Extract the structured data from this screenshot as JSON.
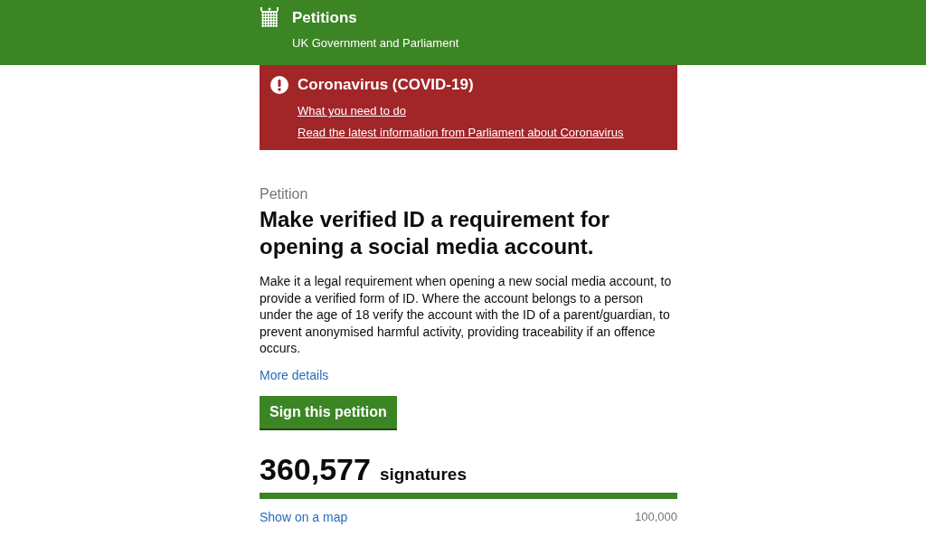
{
  "header": {
    "title": "Petitions",
    "subtitle": "UK Government and Parliament"
  },
  "alert": {
    "title": "Coronavirus (COVID-19)",
    "links": [
      "What you need to do",
      "Read the latest information from Parliament about Coronavirus"
    ]
  },
  "petition": {
    "label": "Petition",
    "title": "Make verified ID a requirement for opening a social media account.",
    "description": "Make it a legal requirement when opening a new social media account, to provide a verified form of ID. Where the account belongs to a person under the age of 18 verify the account with the ID of a parent/guardian, to prevent anonymised harmful activity, providing traceability if an offence occurs.",
    "more_link": "More details",
    "sign_button": "Sign this petition",
    "count": "360,577",
    "count_label": "signatures",
    "progress": {
      "level": 1
    },
    "map_link": "Show on a map",
    "threshold": "100,000"
  }
}
